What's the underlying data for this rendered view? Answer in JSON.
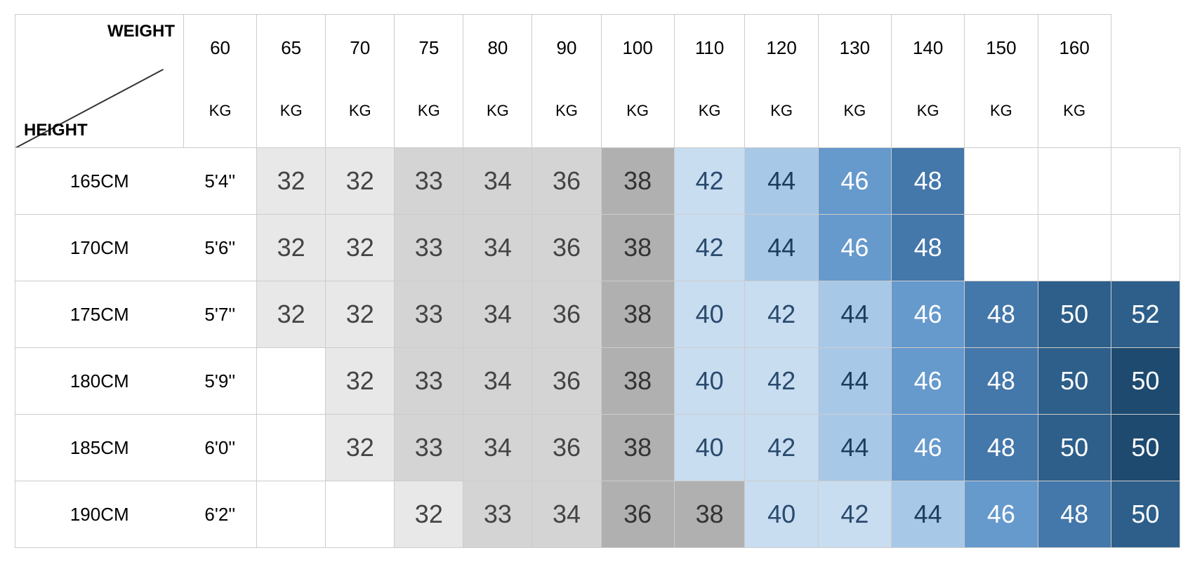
{
  "corner": {
    "weight_label": "WEIGHT",
    "height_label": "HEIGHT"
  },
  "weight_headers": [
    {
      "top": "60",
      "bottom": "KG"
    },
    {
      "top": "65",
      "bottom": "KG"
    },
    {
      "top": "70",
      "bottom": "KG"
    },
    {
      "top": "75",
      "bottom": "KG"
    },
    {
      "top": "80",
      "bottom": "KG"
    },
    {
      "top": "90",
      "bottom": "KG"
    },
    {
      "top": "100",
      "bottom": "KG"
    },
    {
      "top": "110",
      "bottom": "KG"
    },
    {
      "top": "120",
      "bottom": "KG"
    },
    {
      "top": "130",
      "bottom": "KG"
    },
    {
      "top": "140",
      "bottom": "KG"
    },
    {
      "top": "150",
      "bottom": "KG"
    },
    {
      "top": "160",
      "bottom": "KG"
    }
  ],
  "rows": [
    {
      "cm": "165CM",
      "ft": "5'4''",
      "cells": [
        {
          "val": "32",
          "cls": "c-lgray1"
        },
        {
          "val": "32",
          "cls": "c-lgray1"
        },
        {
          "val": "33",
          "cls": "c-lgray2"
        },
        {
          "val": "34",
          "cls": "c-lgray2"
        },
        {
          "val": "36",
          "cls": "c-lgray2"
        },
        {
          "val": "38",
          "cls": "c-gray"
        },
        {
          "val": "42",
          "cls": "c-lblue1"
        },
        {
          "val": "44",
          "cls": "c-lblue2"
        },
        {
          "val": "46",
          "cls": "c-mblue"
        },
        {
          "val": "48",
          "cls": "c-dblue1"
        },
        {
          "val": "",
          "cls": "c-empty"
        },
        {
          "val": "",
          "cls": "c-empty"
        },
        {
          "val": "",
          "cls": "c-empty"
        }
      ]
    },
    {
      "cm": "170CM",
      "ft": "5'6''",
      "cells": [
        {
          "val": "32",
          "cls": "c-lgray1"
        },
        {
          "val": "32",
          "cls": "c-lgray1"
        },
        {
          "val": "33",
          "cls": "c-lgray2"
        },
        {
          "val": "34",
          "cls": "c-lgray2"
        },
        {
          "val": "36",
          "cls": "c-lgray2"
        },
        {
          "val": "38",
          "cls": "c-gray"
        },
        {
          "val": "42",
          "cls": "c-lblue1"
        },
        {
          "val": "44",
          "cls": "c-lblue2"
        },
        {
          "val": "46",
          "cls": "c-mblue"
        },
        {
          "val": "48",
          "cls": "c-dblue1"
        },
        {
          "val": "",
          "cls": "c-empty"
        },
        {
          "val": "",
          "cls": "c-empty"
        },
        {
          "val": "",
          "cls": "c-empty"
        }
      ]
    },
    {
      "cm": "175CM",
      "ft": "5'7''",
      "cells": [
        {
          "val": "32",
          "cls": "c-lgray1"
        },
        {
          "val": "32",
          "cls": "c-lgray1"
        },
        {
          "val": "33",
          "cls": "c-lgray2"
        },
        {
          "val": "34",
          "cls": "c-lgray2"
        },
        {
          "val": "36",
          "cls": "c-lgray2"
        },
        {
          "val": "38",
          "cls": "c-gray"
        },
        {
          "val": "40",
          "cls": "c-lblue1"
        },
        {
          "val": "42",
          "cls": "c-lblue1"
        },
        {
          "val": "44",
          "cls": "c-lblue2"
        },
        {
          "val": "46",
          "cls": "c-mblue"
        },
        {
          "val": "48",
          "cls": "c-dblue1"
        },
        {
          "val": "50",
          "cls": "c-dblue2"
        },
        {
          "val": "52",
          "cls": "c-dblue2"
        }
      ]
    },
    {
      "cm": "180CM",
      "ft": "5'9''",
      "cells": [
        {
          "val": "",
          "cls": "c-empty"
        },
        {
          "val": "32",
          "cls": "c-lgray1"
        },
        {
          "val": "33",
          "cls": "c-lgray2"
        },
        {
          "val": "34",
          "cls": "c-lgray2"
        },
        {
          "val": "36",
          "cls": "c-lgray2"
        },
        {
          "val": "38",
          "cls": "c-gray"
        },
        {
          "val": "40",
          "cls": "c-lblue1"
        },
        {
          "val": "42",
          "cls": "c-lblue1"
        },
        {
          "val": "44",
          "cls": "c-lblue2"
        },
        {
          "val": "46",
          "cls": "c-mblue"
        },
        {
          "val": "48",
          "cls": "c-dblue1"
        },
        {
          "val": "50",
          "cls": "c-dblue2"
        },
        {
          "val": "50",
          "cls": "c-dblue3"
        }
      ]
    },
    {
      "cm": "185CM",
      "ft": "6'0''",
      "cells": [
        {
          "val": "",
          "cls": "c-empty"
        },
        {
          "val": "32",
          "cls": "c-lgray1"
        },
        {
          "val": "33",
          "cls": "c-lgray2"
        },
        {
          "val": "34",
          "cls": "c-lgray2"
        },
        {
          "val": "36",
          "cls": "c-lgray2"
        },
        {
          "val": "38",
          "cls": "c-gray"
        },
        {
          "val": "40",
          "cls": "c-lblue1"
        },
        {
          "val": "42",
          "cls": "c-lblue1"
        },
        {
          "val": "44",
          "cls": "c-lblue2"
        },
        {
          "val": "46",
          "cls": "c-mblue"
        },
        {
          "val": "48",
          "cls": "c-dblue1"
        },
        {
          "val": "50",
          "cls": "c-dblue2"
        },
        {
          "val": "50",
          "cls": "c-dblue3"
        }
      ]
    },
    {
      "cm": "190CM",
      "ft": "6'2''",
      "cells": [
        {
          "val": "",
          "cls": "c-empty"
        },
        {
          "val": "",
          "cls": "c-empty"
        },
        {
          "val": "32",
          "cls": "c-lgray1"
        },
        {
          "val": "33",
          "cls": "c-lgray2"
        },
        {
          "val": "34",
          "cls": "c-lgray2"
        },
        {
          "val": "36",
          "cls": "c-gray"
        },
        {
          "val": "38",
          "cls": "c-gray"
        },
        {
          "val": "40",
          "cls": "c-lblue1"
        },
        {
          "val": "42",
          "cls": "c-lblue1"
        },
        {
          "val": "44",
          "cls": "c-lblue2"
        },
        {
          "val": "46",
          "cls": "c-mblue"
        },
        {
          "val": "48",
          "cls": "c-dblue1"
        },
        {
          "val": "50",
          "cls": "c-dblue2"
        }
      ]
    }
  ]
}
